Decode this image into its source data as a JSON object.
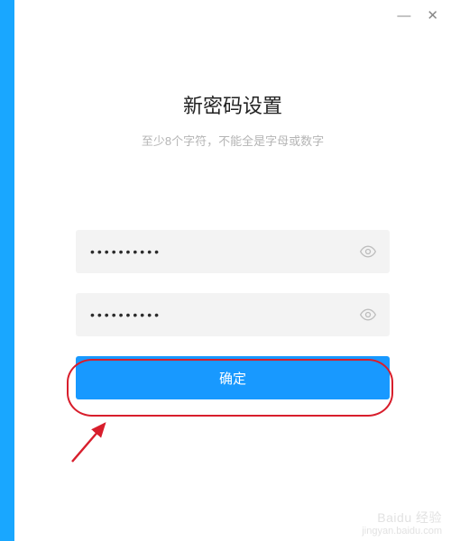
{
  "titlebar": {
    "minimize": "—",
    "close": "✕"
  },
  "heading": "新密码设置",
  "subheading": "至少8个字符，不能全是字母或数字",
  "password1": {
    "value": "••••••••••"
  },
  "password2": {
    "value": "••••••••••"
  },
  "confirm_label": "确定",
  "colors": {
    "accent": "#19a7ff",
    "primary_button": "#1899ff",
    "highlight": "#d81e2c"
  },
  "watermark": {
    "brand": "Baidu 经验",
    "sub": "jingyan.baidu.com"
  }
}
